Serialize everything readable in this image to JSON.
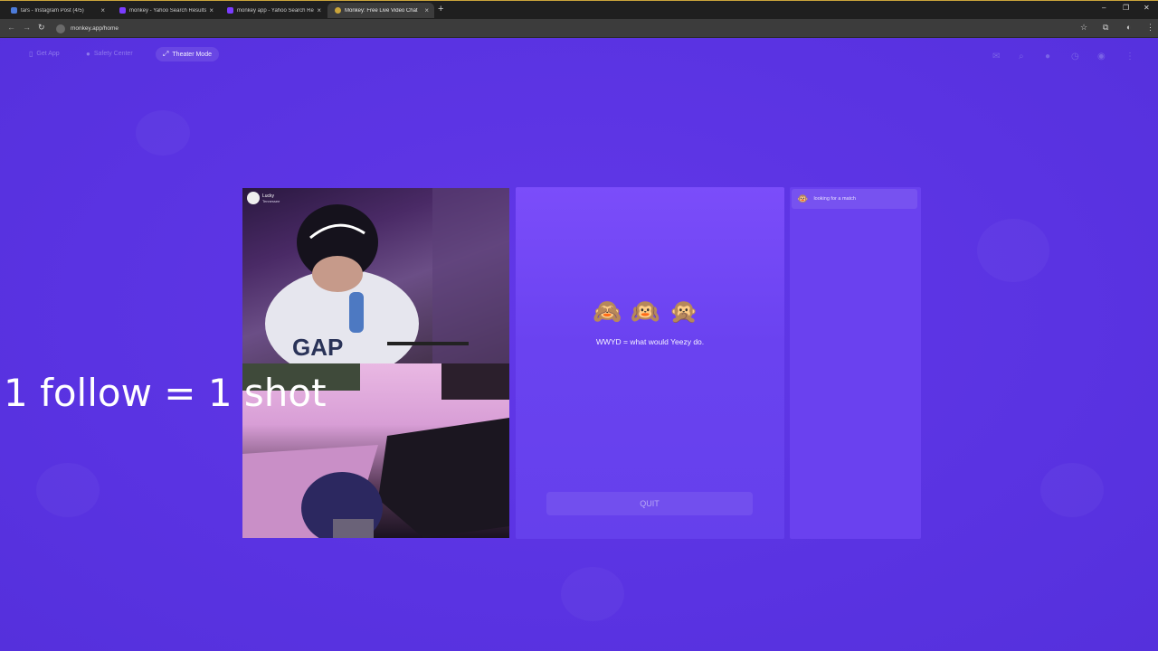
{
  "browser": {
    "tabs": [
      {
        "label": "tars - Instagram Post (4/5)",
        "favicon_color": "#4c7bd9"
      },
      {
        "label": "monkey - Yahoo Search Results",
        "favicon_color": "#7a3cff"
      },
      {
        "label": "monkey app - Yahoo Search Results",
        "favicon_color": "#7a3cff"
      },
      {
        "label": "Monkey: Free Live Video Chat",
        "favicon_color": "#caa43a"
      }
    ],
    "url": "monkey.app/home"
  },
  "topnav": {
    "get_app": "Get App",
    "safety_center": "Safety Center",
    "theater_mode": "Theater Mode"
  },
  "video_top": {
    "username": "Lucky",
    "location": "Tennessee"
  },
  "chat": {
    "emojis": "🙈🙉🙊",
    "tagline": "WWYD = what would Yeezy do.",
    "quit_label": "QUIT"
  },
  "side_panel": {
    "status": "looking for a match",
    "status_icon": "🐵"
  },
  "overlay_caption": "1 follow = 1 shot",
  "colors": {
    "page_bg": "#5a35e4",
    "chat_bg": "#7b4dfa",
    "side_bg": "#6a41ef"
  }
}
